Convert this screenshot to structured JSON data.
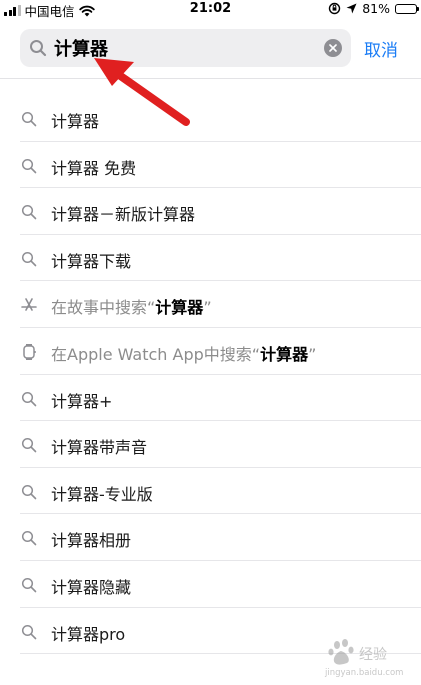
{
  "status_bar": {
    "carrier": "中国电信",
    "time": "21:02",
    "battery": "81%",
    "battery_level": 0.81
  },
  "search": {
    "query": "计算器",
    "cancel_label": "取消"
  },
  "suggestions": [
    {
      "icon": "search-icon",
      "text": "计算器"
    },
    {
      "icon": "search-icon",
      "text": "计算器 免费"
    },
    {
      "icon": "search-icon",
      "text": "计算器－新版计算器"
    },
    {
      "icon": "search-icon",
      "text": "计算器下载"
    },
    {
      "icon": "app-store-icon",
      "prefix": "在故事中搜索“",
      "highlight": "计算器",
      "suffix": "”"
    },
    {
      "icon": "apple-watch-icon",
      "prefix": "在Apple Watch App中搜索“",
      "highlight": "计算器",
      "suffix": "”"
    },
    {
      "icon": "search-icon",
      "text": "计算器+"
    },
    {
      "icon": "search-icon",
      "text": "计算器带声音"
    },
    {
      "icon": "search-icon",
      "text": "计算器-专业版"
    },
    {
      "icon": "search-icon",
      "text": "计算器相册"
    },
    {
      "icon": "search-icon",
      "text": "计算器隐藏"
    },
    {
      "icon": "search-icon",
      "text": "计算器pro"
    }
  ],
  "annotation": {
    "arrow_color": "#e02020"
  },
  "watermark": {
    "text": "Baidu经验",
    "url_text": "jingyan.baidu.com"
  },
  "colors": {
    "accent": "#1a7cf5",
    "field_bg": "#eeeef0",
    "separator": "#e6e6e9"
  }
}
